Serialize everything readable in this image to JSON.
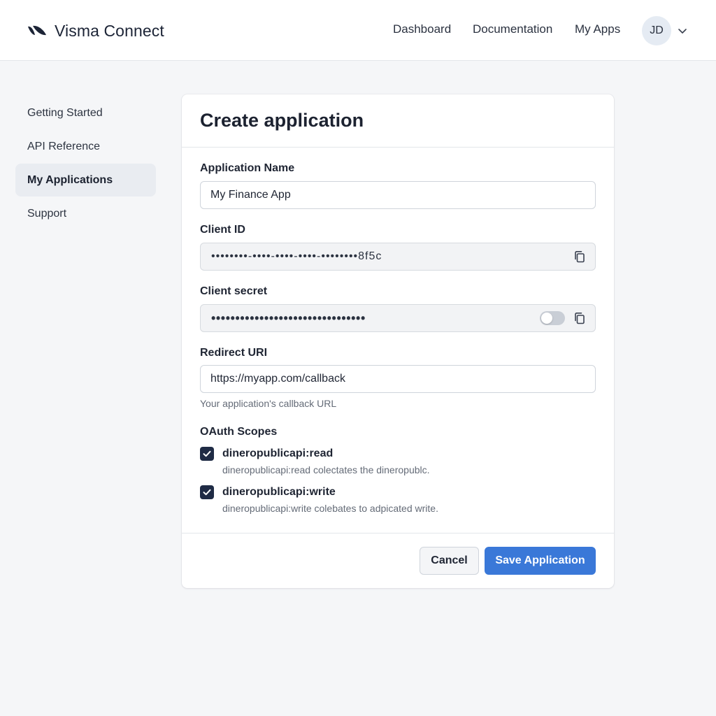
{
  "header": {
    "brand_name": "Visma Connect",
    "brand_icon": "visma-logo-icon",
    "nav": [
      {
        "label": "Dashboard"
      },
      {
        "label": "Documentation"
      },
      {
        "label": "My Apps"
      }
    ],
    "user_initials": "JD",
    "user_menu_icon": "chevron-down-icon"
  },
  "sidebar": {
    "items": [
      {
        "label": "Getting Started",
        "active": false
      },
      {
        "label": "API Reference",
        "active": false
      },
      {
        "label": "My Applications",
        "active": true
      },
      {
        "label": "Support",
        "active": false
      }
    ]
  },
  "form": {
    "title": "Create application",
    "app_name": {
      "label": "Application Name",
      "value": "My Finance App"
    },
    "client_id": {
      "label": "Client ID",
      "value": "••••••••-••••-••••-••••-••••••••8f5c",
      "copy_icon": "copy-icon"
    },
    "client_secret": {
      "label": "Client secret",
      "value": "••••••••••••••••••••••••••••••••",
      "reveal_toggle": false,
      "copy_icon": "copy-icon"
    },
    "redirect_uri": {
      "label": "Redirect URI",
      "value": "https://myapp.com/callback",
      "help": "Your application's callback URL"
    },
    "scopes": {
      "label": "OAuth Scopes",
      "items": [
        {
          "name": "dineropublicapi:read",
          "description": "dineropublicapi:read colectates the dineropublc.",
          "checked": true
        },
        {
          "name": "dineropublicapi:write",
          "description": "dineropublicapi:write colebates to adpicated write.",
          "checked": true
        }
      ]
    },
    "cancel_label": "Cancel",
    "save_label": "Save Application"
  },
  "colors": {
    "primary": "#3a78d8",
    "checkbox": "#1f2b45",
    "background": "#f5f6f8",
    "active_nav": "#e9ecf1"
  }
}
